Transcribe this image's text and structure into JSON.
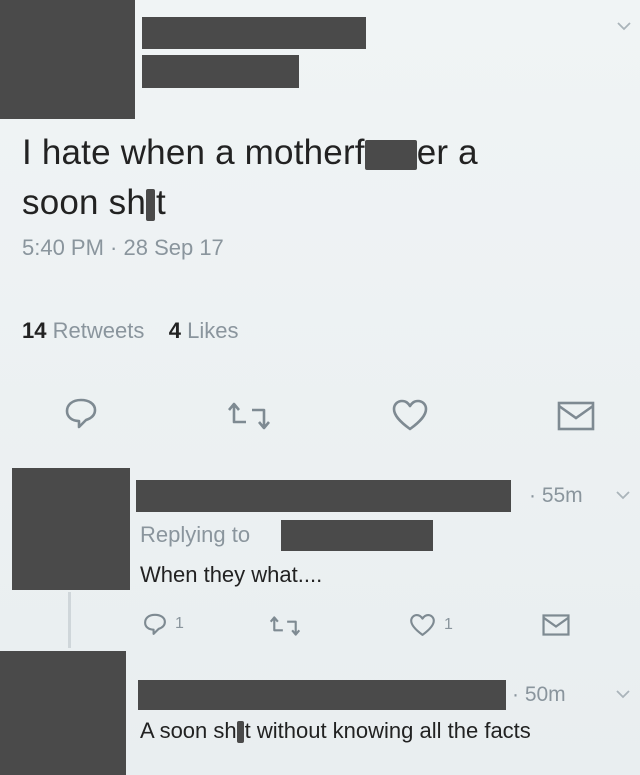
{
  "main_tweet": {
    "text_line1_a": "I hate when a motherf",
    "text_line1_b": "er a",
    "text_line2_a": "soon sh",
    "text_line2_b": "t",
    "timestamp": "5:40 PM · 28 Sep 17",
    "retweets_count": "14",
    "retweets_label": "Retweets",
    "likes_count": "4",
    "likes_label": "Likes"
  },
  "reply1": {
    "time": "· 55m",
    "replying_to": "Replying to",
    "text": "When they what....",
    "reply_count": "1",
    "like_count": "1"
  },
  "reply2": {
    "time": "· 50m",
    "text_a": "A soon sh",
    "text_b": "t without knowing all the facts"
  },
  "icons": [
    "chevron-down-icon",
    "reply-icon",
    "retweet-icon",
    "heart-icon",
    "message-icon"
  ],
  "colors": {
    "redaction": "#4a4a4a",
    "muted": "#8a959d",
    "text": "#222222"
  }
}
